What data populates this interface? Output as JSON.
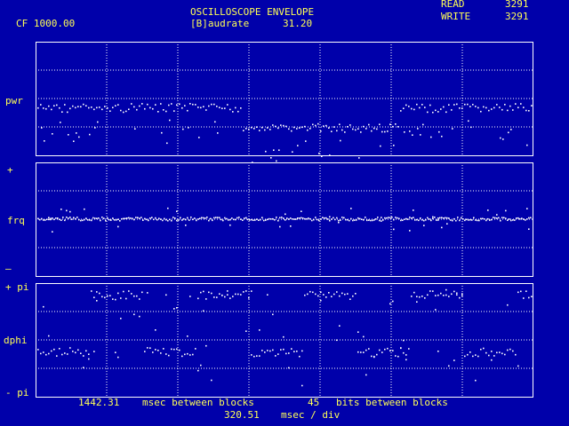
{
  "header": {
    "title": "OSCILLOSCOPE ENVELOPE",
    "cf": "CF 1000.00",
    "baudrate_label": "[B]audrate",
    "baudrate_value": "31.20",
    "read_label": "READ",
    "read_value": "3291",
    "write_label": "WRITE",
    "write_value": "3291"
  },
  "panels": {
    "pwr": {
      "label": "pwr"
    },
    "frq": {
      "label": "frq",
      "plus": "+",
      "minus": "–"
    },
    "dphi": {
      "label": "dphi",
      "plus": "+ pi",
      "minus": "- pi"
    }
  },
  "footer": {
    "msec_value": "1442.31",
    "msec_text": "msec between blocks",
    "bits_value": "45",
    "bits_text": "bits between blocks",
    "div_value": "320.51",
    "div_text": "msec / div"
  },
  "colors": {
    "background": "#0000aa",
    "text": "#ffff55",
    "grid": "#ffffff",
    "trace": "#ffffff"
  }
}
